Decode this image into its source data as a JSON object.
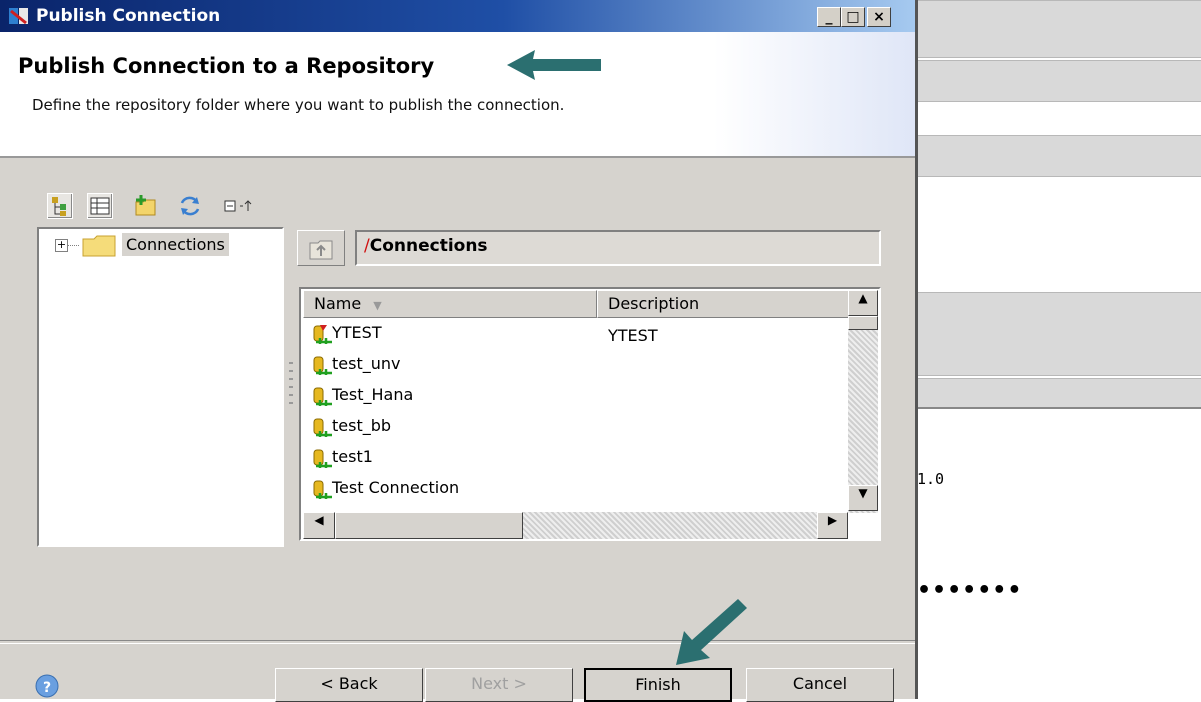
{
  "window": {
    "title": "Publish Connection",
    "min_label": "_",
    "max_label": "□",
    "close_label": "×"
  },
  "header": {
    "title": "Publish Connection to a Repository",
    "description": "Define the repository folder where you want to publish the connection."
  },
  "tree": {
    "root_label": "Connections",
    "expander": "+"
  },
  "path": {
    "slash": "/",
    "folder": "Connections"
  },
  "list": {
    "columns": [
      "Name",
      "Description"
    ],
    "rows": [
      {
        "name": "YTEST",
        "description": "YTEST"
      },
      {
        "name": "test_unv",
        "description": ""
      },
      {
        "name": "Test_Hana",
        "description": ""
      },
      {
        "name": "test_bb",
        "description": ""
      },
      {
        "name": "test1",
        "description": ""
      },
      {
        "name": "Test Connection",
        "description": ""
      }
    ]
  },
  "buttons": {
    "back": "< Back",
    "next": "Next >",
    "finish": "Finish",
    "cancel": "Cancel"
  },
  "background": {
    "version_text": "1.0",
    "password_mask": "•••••••"
  },
  "colors": {
    "titlebar": "#0a246a",
    "arrow": "#2b6f70",
    "path_slash": "#d01010"
  }
}
